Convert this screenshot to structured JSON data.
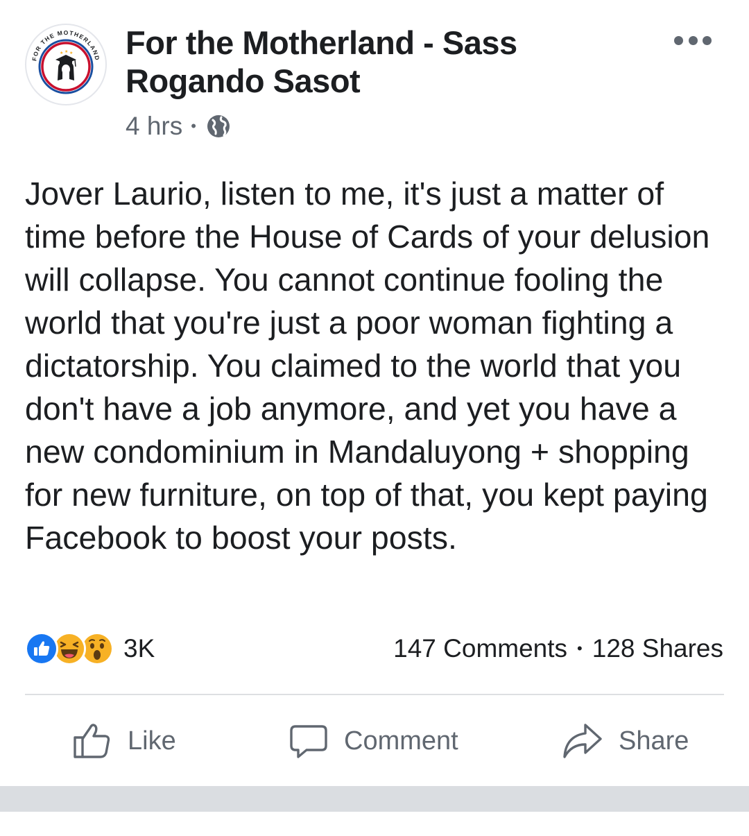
{
  "post": {
    "page_name": "For the Motherland - Sass Rogando Sasot",
    "avatar_text": "FOR THE MOTHERLAND",
    "timestamp": "4 hrs",
    "separator": "•",
    "privacy_icon": "globe-icon",
    "more_icon": "more-horizontal-icon",
    "body": "Jover Laurio, listen to me, it's just a matter of time before the House of Cards of your delusion will collapse. You cannot continue fooling the world that you're just a poor woman fighting a dictatorship. You claimed to the world that you don't have a job anymore, and yet you have a new condominium in Mandaluyong + shopping for new furniture, on top of that, you kept paying Facebook to boost your posts."
  },
  "engagement": {
    "reaction_icons": [
      "like-reaction-icon",
      "haha-reaction-icon",
      "wow-reaction-icon"
    ],
    "reaction_count": "3K",
    "comments": "147 Comments",
    "separator": "•",
    "shares": "128 Shares"
  },
  "actions": {
    "like_label": "Like",
    "comment_label": "Comment",
    "share_label": "Share"
  },
  "colors": {
    "text_primary": "#1c1e21",
    "text_secondary": "#606770",
    "like_blue": "#1877f2",
    "reaction_yellow": "#f7b125",
    "divider": "#dddfe2",
    "avatar_ring_red": "#c8102e",
    "avatar_ring_blue": "#1a4fa0"
  }
}
